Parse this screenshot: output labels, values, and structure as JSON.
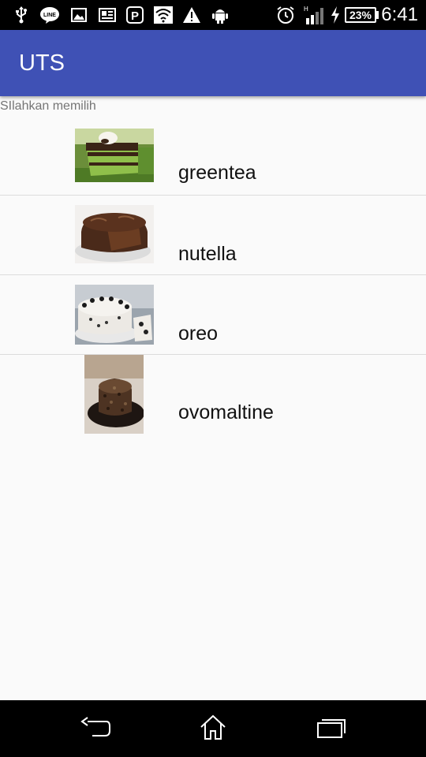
{
  "status_bar": {
    "time": "6:41",
    "battery": "23%",
    "icons": [
      "usb-icon",
      "line-app-icon",
      "image-icon",
      "news-icon",
      "app-p-icon",
      "wifi-icon",
      "warning-icon",
      "android-icon",
      "alarm-icon",
      "signal-icon",
      "charging-icon"
    ]
  },
  "app_bar": {
    "title": "UTS"
  },
  "subtitle": "SIlahkan memilih",
  "items": [
    {
      "label": "greentea",
      "image": "greentea-cake-photo"
    },
    {
      "label": "nutella",
      "image": "chocolate-cake-photo"
    },
    {
      "label": "oreo",
      "image": "oreo-cake-photo"
    },
    {
      "label": "ovomaltine",
      "image": "ovomaltine-cake-photo"
    }
  ],
  "colors": {
    "primary": "#3f51b5",
    "background": "#fafafa",
    "subtitle": "#757575"
  },
  "nav_bar": {
    "icons": [
      "back-icon",
      "home-icon",
      "recents-icon"
    ]
  }
}
